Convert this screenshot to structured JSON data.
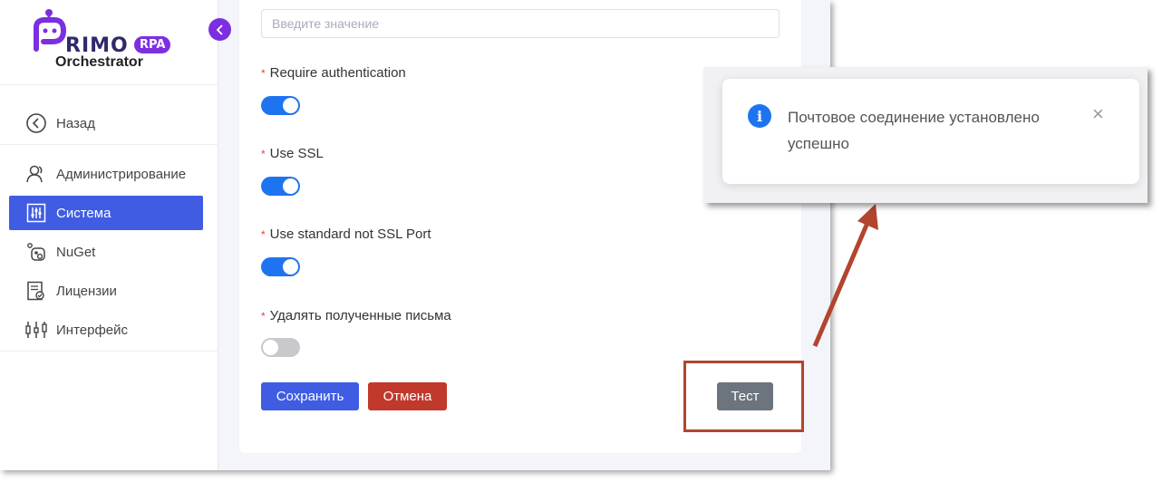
{
  "logo": {
    "brand": "RIMO",
    "badge": "RPA",
    "subtitle": "Orchestrator"
  },
  "sidebar": {
    "back_label": "Назад",
    "items": [
      {
        "label": "Администрирование",
        "icon": "users-icon"
      },
      {
        "label": "Система",
        "icon": "sliders-icon",
        "active": true
      },
      {
        "label": "NuGet",
        "icon": "nuget-icon"
      },
      {
        "label": "Лицензии",
        "icon": "license-icon"
      },
      {
        "label": "Интерфейс",
        "icon": "interface-icon"
      }
    ]
  },
  "form": {
    "input_placeholder": "Введите значение",
    "fields": [
      {
        "label": "Require authentication",
        "enabled": true
      },
      {
        "label": "Use SSL",
        "enabled": true
      },
      {
        "label": "Use standard not SSL Port",
        "enabled": true
      },
      {
        "label": "Удалять полученные письма",
        "enabled": false
      }
    ],
    "required_mark": "*",
    "save_label": "Сохранить",
    "cancel_label": "Отмена",
    "test_label": "Тест"
  },
  "notification": {
    "message": "Почтовое соединение установлено успешно",
    "icon": "info-icon",
    "close_glyph": "×"
  },
  "colors": {
    "accent": "#3f5ce3",
    "brand_purple": "#7b2fe0",
    "toggle_on": "#1e74f0",
    "cancel": "#c0392b",
    "test": "#6c757d",
    "annotation": "#b2452f"
  }
}
